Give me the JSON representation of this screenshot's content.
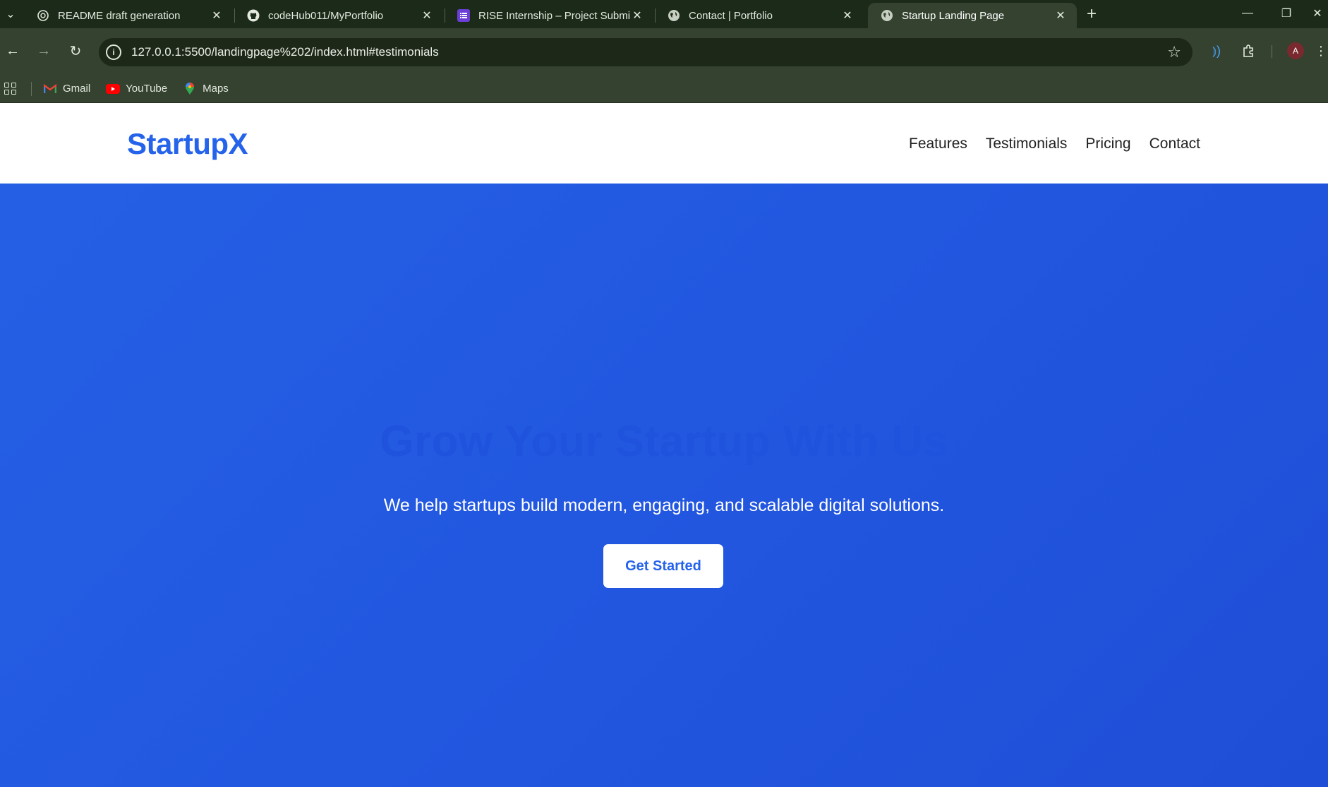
{
  "browser": {
    "tabs": [
      {
        "title": "README draft generation",
        "icon": "openai-icon"
      },
      {
        "title": "codeHub011/MyPortfolio",
        "icon": "github-icon"
      },
      {
        "title": "RISE Internship – Project Submi",
        "icon": "forms-icon"
      },
      {
        "title": "Contact | Portfolio",
        "icon": "globe-icon"
      },
      {
        "title": "Startup Landing Page",
        "icon": "globe-icon",
        "active": true
      }
    ],
    "url": "127.0.0.1:5500/landingpage%202/index.html#testimonials",
    "profile_initial": "A",
    "bookmarks": [
      {
        "label": "Gmail",
        "icon": "gmail-icon"
      },
      {
        "label": "YouTube",
        "icon": "youtube-icon"
      },
      {
        "label": "Maps",
        "icon": "maps-icon"
      }
    ]
  },
  "site": {
    "logo": "StartupX",
    "nav": [
      "Features",
      "Testimonials",
      "Pricing",
      "Contact"
    ],
    "hero": {
      "title": "Grow Your Startup With Us",
      "subtitle": "We help startups build modern, engaging, and scalable digital solutions.",
      "cta_label": "Get Started"
    }
  },
  "colors": {
    "brand_blue": "#2563eb",
    "hero_bg": "#2459e0",
    "chrome_dark": "#1c2b19",
    "chrome_toolbar": "#34422f"
  }
}
